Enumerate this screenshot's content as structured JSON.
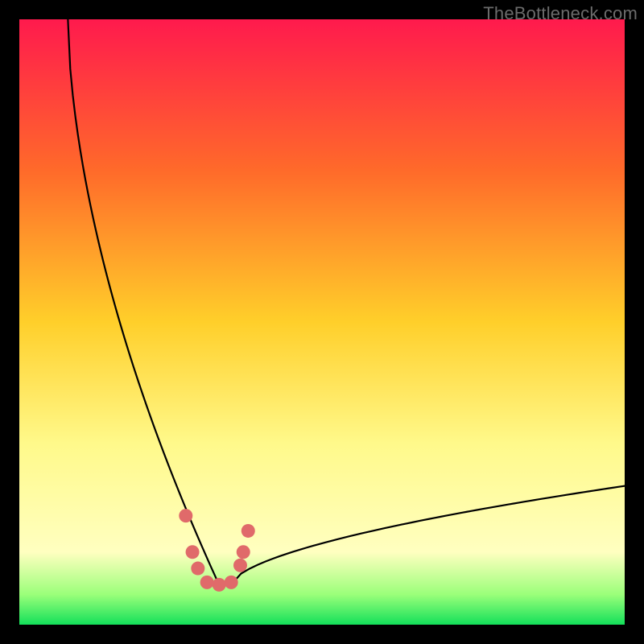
{
  "watermark": "TheBottleneck.com",
  "chart_data": {
    "type": "line",
    "title": "",
    "xlabel": "",
    "ylabel": "",
    "xlim": [
      0,
      100
    ],
    "ylim": [
      0,
      100
    ],
    "gradient_stops": [
      {
        "offset": 0,
        "color": "#ff1a4d"
      },
      {
        "offset": 25,
        "color": "#ff6a2a"
      },
      {
        "offset": 50,
        "color": "#ffcf2a"
      },
      {
        "offset": 70,
        "color": "#fff98a"
      },
      {
        "offset": 88,
        "color": "#ffffc0"
      },
      {
        "offset": 95,
        "color": "#9bff7a"
      },
      {
        "offset": 100,
        "color": "#13e05a"
      }
    ],
    "series": [
      {
        "name": "bottleneck-curve",
        "x_min_percent": 33,
        "left_start_x": 8,
        "right_end_x": 100,
        "right_end_y": 23
      }
    ],
    "markers": {
      "color": "#e06a6a",
      "points": [
        {
          "x": 27.5,
          "y": 82.0
        },
        {
          "x": 28.6,
          "y": 88.0
        },
        {
          "x": 29.5,
          "y": 90.7
        },
        {
          "x": 31.0,
          "y": 93.0
        },
        {
          "x": 33.0,
          "y": 93.4
        },
        {
          "x": 35.0,
          "y": 93.0
        },
        {
          "x": 36.5,
          "y": 90.2
        },
        {
          "x": 37.0,
          "y": 88.0
        },
        {
          "x": 37.8,
          "y": 84.5
        }
      ]
    }
  }
}
